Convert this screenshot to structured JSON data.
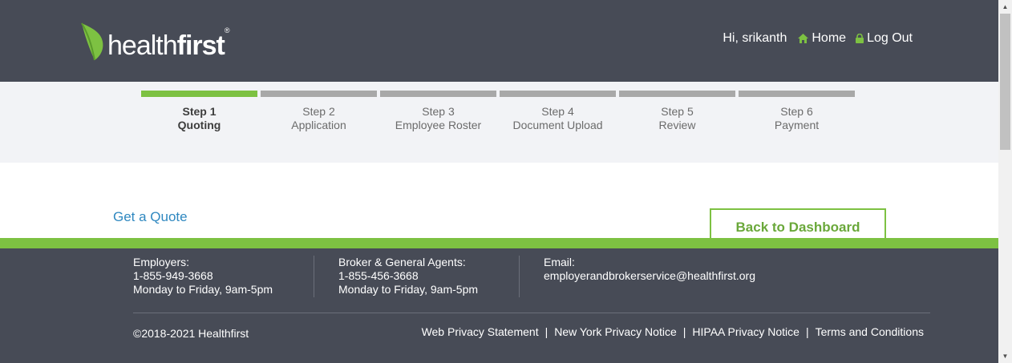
{
  "header": {
    "logo_light": "health",
    "logo_bold": "first",
    "logo_reg": "®",
    "greeting": "Hi, srikanth",
    "home_label": "Home",
    "logout_label": "Log Out",
    "home_icon": "home-icon",
    "logout_icon": "lock-icon"
  },
  "steps": [
    {
      "num": "Step 1",
      "name": "Quoting",
      "active": true
    },
    {
      "num": "Step 2",
      "name": "Application",
      "active": false
    },
    {
      "num": "Step 3",
      "name": "Employee Roster",
      "active": false
    },
    {
      "num": "Step 4",
      "name": "Document Upload",
      "active": false
    },
    {
      "num": "Step 5",
      "name": "Review",
      "active": false
    },
    {
      "num": "Step 6",
      "name": "Payment",
      "active": false
    }
  ],
  "main": {
    "title": "Get a Quote",
    "back_button": "Back to Dashboard"
  },
  "footer": {
    "employers": {
      "label": "Employers:",
      "phone": "1-855-949-3668",
      "hours": "Monday to Friday, 9am-5pm"
    },
    "brokers": {
      "label": "Broker & General Agents:",
      "phone": "1-855-456-3668",
      "hours": "Monday to Friday, 9am-5pm"
    },
    "email": {
      "label": "Email:",
      "address": "employerandbrokerservice@healthfirst.org"
    },
    "copyright": "©2018-2021 Healthfirst",
    "links": [
      "Web Privacy Statement",
      "New York Privacy Notice",
      "HIPAA Privacy Notice",
      "Terms and Conditions"
    ]
  },
  "colors": {
    "header_bg": "#474b56",
    "brand_green": "#7dc142",
    "link_blue": "#2f88c0",
    "step_inactive": "#a8a8a8"
  }
}
